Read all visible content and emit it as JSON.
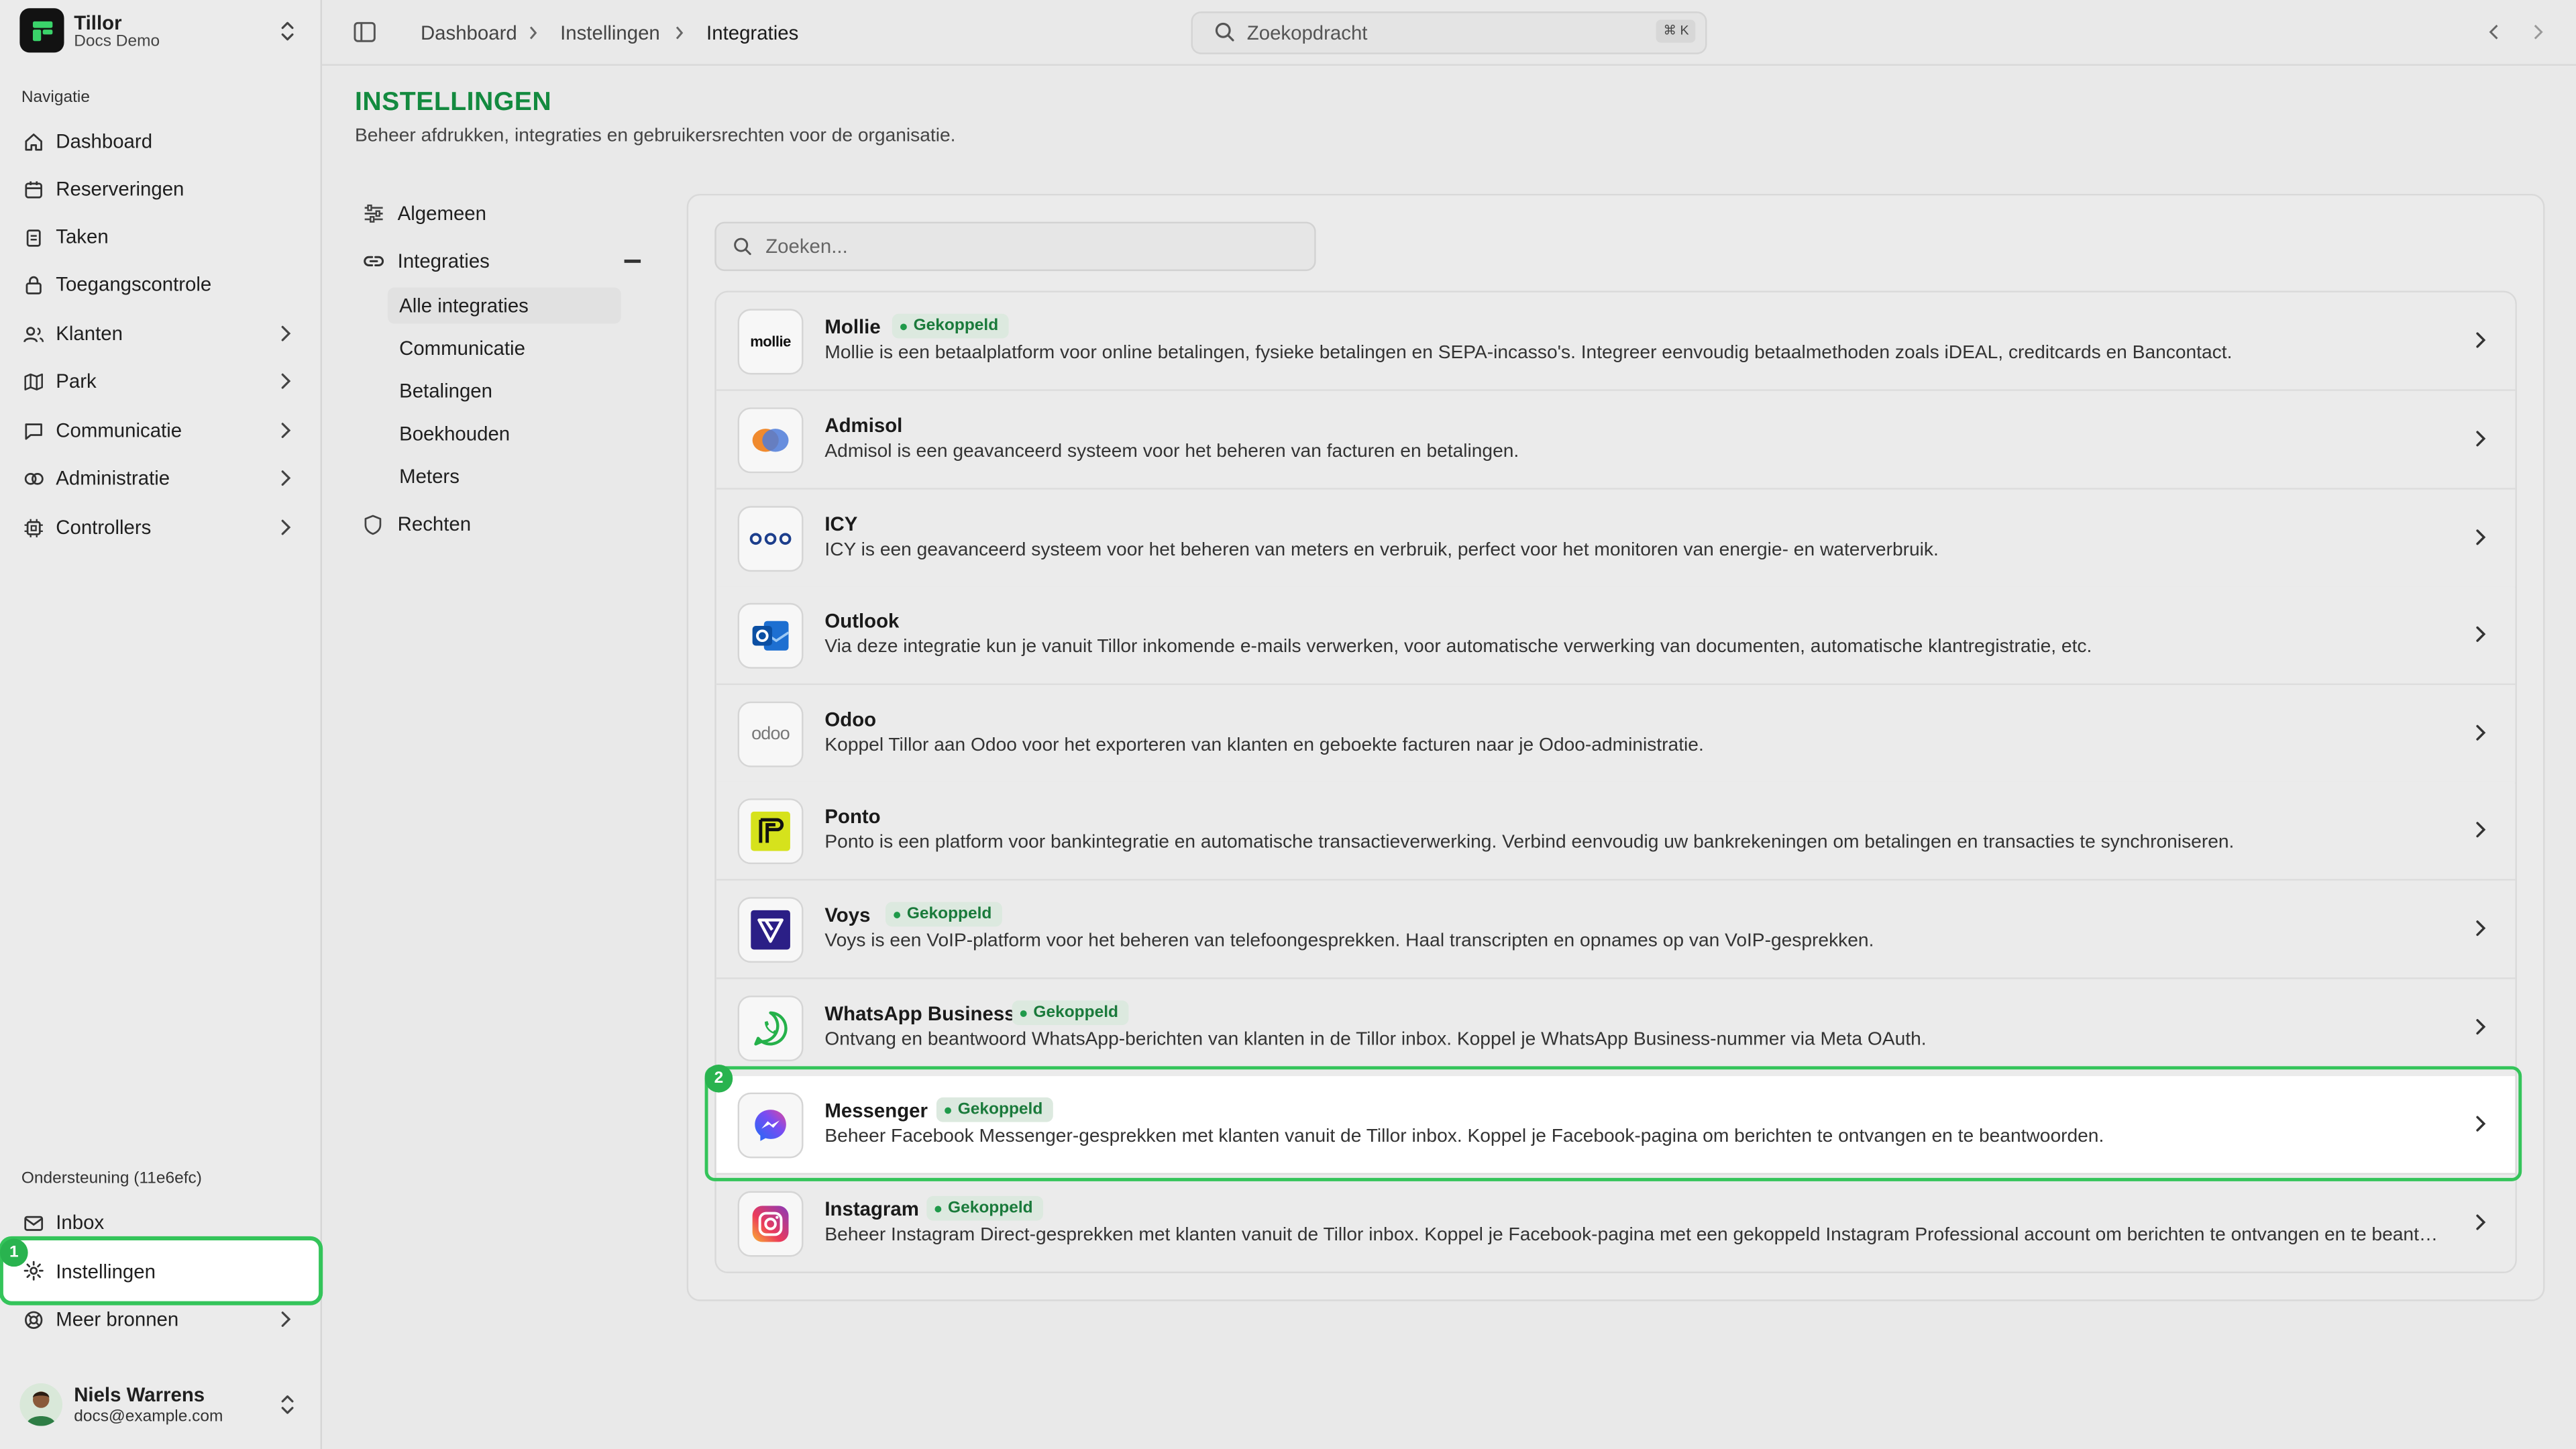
{
  "app": {
    "name": "Tillor",
    "workspace": "Docs Demo"
  },
  "sidebar": {
    "nav_label": "Navigatie",
    "items": [
      {
        "label": "Dashboard",
        "icon": "home-icon",
        "has_children": false
      },
      {
        "label": "Reserveringen",
        "icon": "calendar-icon",
        "has_children": false
      },
      {
        "label": "Taken",
        "icon": "clipboard-icon",
        "has_children": false
      },
      {
        "label": "Toegangscontrole",
        "icon": "lock-icon",
        "has_children": false
      },
      {
        "label": "Klanten",
        "icon": "users-icon",
        "has_children": true
      },
      {
        "label": "Park",
        "icon": "map-icon",
        "has_children": true
      },
      {
        "label": "Communicatie",
        "icon": "message-icon",
        "has_children": true
      },
      {
        "label": "Administratie",
        "icon": "coins-icon",
        "has_children": true
      },
      {
        "label": "Controllers",
        "icon": "chip-icon",
        "has_children": true
      }
    ],
    "support_label": "Ondersteuning (11e6efc)",
    "support_items": [
      {
        "label": "Inbox",
        "icon": "inbox-icon"
      },
      {
        "label": "Instellingen",
        "icon": "gear-icon",
        "active": true,
        "step": "1"
      },
      {
        "label": "Meer bronnen",
        "icon": "lifebuoy-icon",
        "has_children": true
      }
    ],
    "user": {
      "name": "Niels Warrens",
      "email": "docs@example.com"
    }
  },
  "topbar": {
    "breadcrumb": [
      "Dashboard",
      "Instellingen",
      "Integraties"
    ],
    "search_placeholder": "Zoekopdracht",
    "search_shortcut": "⌘ K"
  },
  "page": {
    "title": "INSTELLINGEN",
    "subtitle": "Beheer afdrukken, integraties en gebruikersrechten voor de organisatie."
  },
  "settings_nav": {
    "items": [
      {
        "label": "Algemeen",
        "icon": "sliders-icon"
      },
      {
        "label": "Integraties",
        "icon": "link-icon",
        "expanded": true
      },
      {
        "label": "Rechten",
        "icon": "shield-icon"
      }
    ],
    "sub_items": [
      "Alle integraties",
      "Communicatie",
      "Betalingen",
      "Boekhouden",
      "Meters"
    ],
    "active_sub": "Alle integraties"
  },
  "integrations": {
    "search_placeholder": "Zoeken...",
    "connected_label": "Gekoppeld",
    "items": [
      {
        "name": "Mollie",
        "connected": true,
        "logo": "mollie-logo",
        "description": "Mollie is een betaalplatform voor online betalingen, fysieke betalingen en SEPA-incasso's. Integreer eenvoudig betaalmethoden zoals iDEAL, creditcards en Bancontact."
      },
      {
        "name": "Admisol",
        "connected": false,
        "logo": "admisol-logo",
        "description": "Admisol is een geavanceerd systeem voor het beheren van facturen en betalingen."
      },
      {
        "name": "ICY",
        "connected": false,
        "logo": "icy-logo",
        "description": "ICY is een geavanceerd systeem voor het beheren van meters en verbruik, perfect voor het monitoren van energie- en waterverbruik."
      },
      {
        "name": "Outlook",
        "connected": false,
        "logo": "outlook-logo",
        "description": "Via deze integratie kun je vanuit Tillor inkomende e-mails verwerken, voor automatische verwerking van documenten, automatische klantregistratie, etc."
      },
      {
        "name": "Odoo",
        "connected": false,
        "logo": "odoo-logo",
        "description": "Koppel Tillor aan Odoo voor het exporteren van klanten en geboekte facturen naar je Odoo-administratie."
      },
      {
        "name": "Ponto",
        "connected": false,
        "logo": "ponto-logo",
        "description": "Ponto is een platform voor bankintegratie en automatische transactieverwerking. Verbind eenvoudig uw bankrekeningen om betalingen en transacties te synchroniseren."
      },
      {
        "name": "Voys",
        "connected": true,
        "logo": "voys-logo",
        "description": "Voys is een VoIP-platform voor het beheren van telefoongesprekken. Haal transcripten en opnames op van VoIP-gesprekken."
      },
      {
        "name": "WhatsApp Business",
        "connected": true,
        "logo": "whatsapp-logo",
        "description": "Ontvang en beantwoord WhatsApp-berichten van klanten in de Tillor inbox. Koppel je WhatsApp Business-nummer via Meta OAuth."
      },
      {
        "name": "Messenger",
        "connected": true,
        "logo": "messenger-logo",
        "highlighted": true,
        "step": "2",
        "description": "Beheer Facebook Messenger-gesprekken met klanten vanuit de Tillor inbox. Koppel je Facebook-pagina om berichten te ontvangen en te beantwoorden."
      },
      {
        "name": "Instagram",
        "connected": true,
        "logo": "instagram-logo",
        "description": "Beheer Instagram Direct-gesprekken met klanten vanuit de Tillor inbox. Koppel je Facebook-pagina met een gekoppeld Instagram Professional account om berichten te ontvangen en te beantwoorden."
      }
    ]
  },
  "colors": {
    "accent_green": "#138a3f",
    "highlight_green": "#34c45a",
    "badge_bg": "#dce9df",
    "background": "#e9e9e9"
  }
}
